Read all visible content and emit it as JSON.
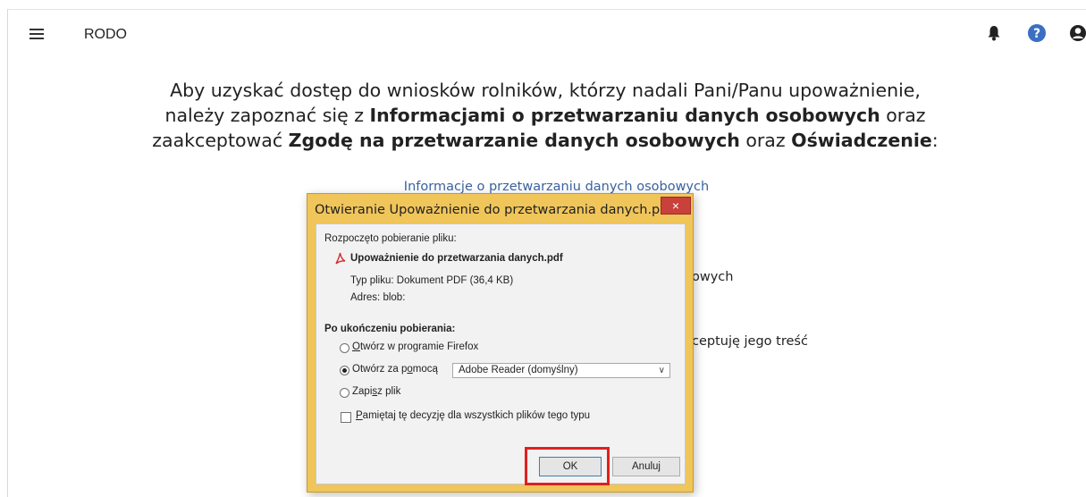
{
  "header": {
    "title": "RODO"
  },
  "main": {
    "intro_prefix_1": "Aby uzyskać dostęp do wniosków rolników, którzy nadali Pani/Panu upoważnienie,",
    "intro_prefix_2": "należy zapoznać się z ",
    "intro_bold_1": "Informacjami o przetwarzaniu danych osobowych",
    "intro_mid_1": " oraz",
    "intro_prefix_3": "zaakceptować ",
    "intro_bold_2": "Zgodę na przetwarzanie danych osobowych",
    "intro_mid_2": " oraz ",
    "intro_bold_3": "Oświadczenie",
    "intro_suffix": ":",
    "info_link": "Informacje o przetwarzaniu danych osobowych",
    "partial_text_1": "owych",
    "partial_text_2": "ceptuję jego treść"
  },
  "dialog": {
    "title": "Otwieranie Upoważnienie do przetwarzania danych.pdf",
    "close_label": "×",
    "download_started": "Rozpoczęto pobieranie pliku:",
    "file_name": "Upoważnienie do przetwarzania danych.pdf",
    "file_type": "Typ pliku: Dokument PDF (36,4 KB)",
    "address_label": "Adres:",
    "address_value": "blob:",
    "after_download": "Po ukończeniu pobierania:",
    "options": {
      "open_firefox_first": "O",
      "open_firefox_rest": "twórz w programie Firefox",
      "open_with_pre": "Otwórz za p",
      "open_with_u": "o",
      "open_with_post": "mocą",
      "save_pre": "Zapi",
      "save_u": "s",
      "save_post": "z plik"
    },
    "selected_option": "open_with",
    "app_select": "Adobe Reader (domyślny)",
    "remember_pre": "P",
    "remember_rest": "amiętaj tę decyzję dla wszystkich plików tego typu",
    "remember_checked": false,
    "ok_label": "OK",
    "cancel_label": "Anuluj"
  },
  "colors": {
    "dialog_frame": "#f0c55a",
    "close_button": "#c8413a",
    "highlight": "#e0201f",
    "link": "#3b62a0",
    "help_icon": "#3b6fc2"
  }
}
